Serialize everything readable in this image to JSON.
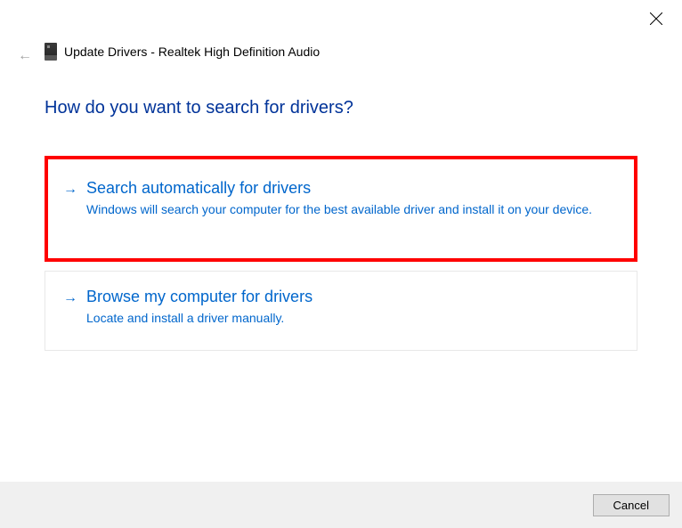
{
  "header": {
    "title": "Update Drivers - Realtek High Definition Audio"
  },
  "main": {
    "heading": "How do you want to search for drivers?",
    "options": [
      {
        "title": "Search automatically for drivers",
        "description": "Windows will search your computer for the best available driver and install it on your device.",
        "highlighted": true
      },
      {
        "title": "Browse my computer for drivers",
        "description": "Locate and install a driver manually.",
        "highlighted": false
      }
    ]
  },
  "footer": {
    "cancel_label": "Cancel"
  }
}
